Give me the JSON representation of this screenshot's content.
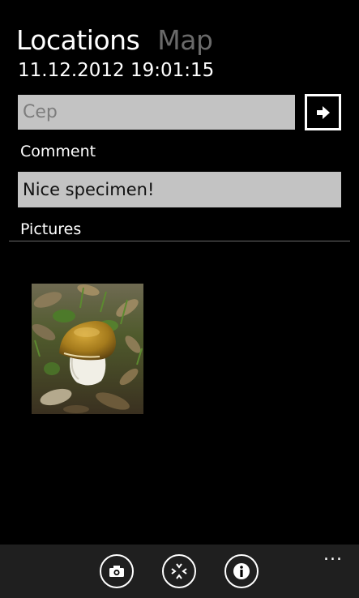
{
  "header": {
    "pivot_active": "Locations",
    "pivot_inactive": "Map",
    "timestamp": "11.12.2012 19:01:15"
  },
  "form": {
    "name_value": "Cep",
    "comment_label": "Comment",
    "comment_value": "Nice specimen!",
    "pictures_label": "Pictures"
  },
  "appbar": {
    "buttons": [
      "camera-icon",
      "center-icon",
      "info-icon"
    ],
    "more": "..."
  },
  "colors": {
    "background": "#000000",
    "field": "#c3c3c3",
    "appbar": "#1f1f1f",
    "inactive_text": "#6a6a6a"
  }
}
